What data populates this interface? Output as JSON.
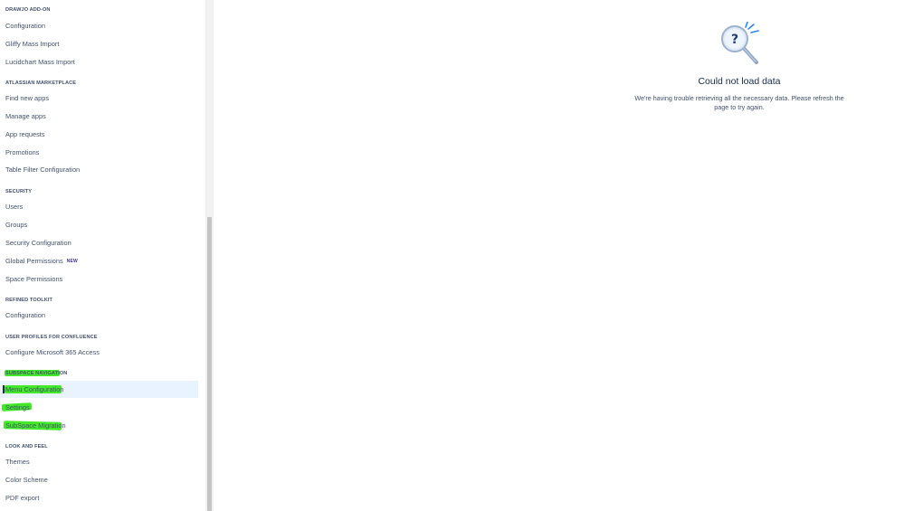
{
  "sidebar": {
    "sections": {
      "drawio": "DRAWJO ADD-ON",
      "marketplace": "ATLASSIAN MARKETPLACE",
      "security": "SECURITY",
      "refined": "REFINED TOOLKIT",
      "userprofiles": "USER PROFILES FOR CONFLUENCE",
      "subspace": "SUBSPACE NAVIGATION",
      "lookfeel": "LOOK AND FEEL"
    },
    "items": {
      "drawio_configuration": "Configuration",
      "gliffy_import": "Gliffy Mass Import",
      "lucidchart_import": "Lucidchart Mass Import",
      "find_new_apps": "Find new apps",
      "manage_apps": "Manage apps",
      "app_requests": "App requests",
      "promotions": "Promotions",
      "table_filter": "Table Filter Configuration",
      "users": "Users",
      "groups": "Groups",
      "security_configuration": "Security Configuration",
      "global_permissions": "Global Permissions",
      "global_permissions_badge": "NEW",
      "space_permissions": "Space Permissions",
      "refined_configuration": "Configuration",
      "configure_m365": "Configure Microsoft 365 Access",
      "menu_configuration": "Menu Configuration",
      "settings": "Settings",
      "subspace_migration": "SubSpace Migration",
      "themes": "Themes",
      "color_scheme": "Color Scheme",
      "pdf_export": "PDF export"
    }
  },
  "main": {
    "error_title": "Could not load data",
    "error_message": "We're having trouble retrieving all the necessary data. Please refresh the page to try again.",
    "illustration_icon": "magnifier-question-icon"
  },
  "colors": {
    "highlight": "#39e81e",
    "active_item_bg": "#e9f2ff",
    "badge": "#403294"
  }
}
